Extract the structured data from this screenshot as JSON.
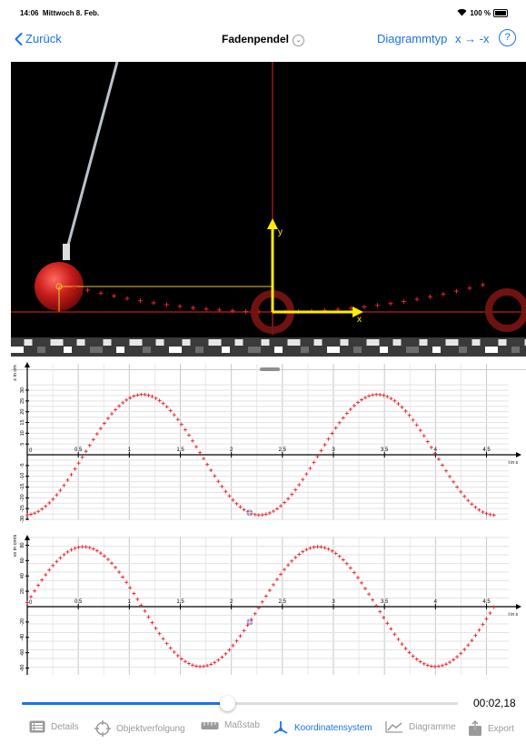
{
  "status": {
    "time": "14:06",
    "date": "Mittwoch 8. Feb.",
    "battery": "100 %"
  },
  "nav": {
    "back": "Zurück",
    "title": "Fadenpendel",
    "diagram_type": "Diagrammtyp",
    "flip": "x → -x",
    "help": "?"
  },
  "video": {
    "axis_x": "x",
    "axis_y": "y"
  },
  "chart_data": [
    {
      "type": "scatter",
      "x_label": "t in s",
      "y_label": "x in cm",
      "xlim": [
        0,
        4.6
      ],
      "ylim": [
        -30,
        30
      ],
      "x_ticks": [
        "0,5",
        "1",
        "1,5",
        "2",
        "2,5",
        "3",
        "3,5",
        "4",
        "4,5"
      ],
      "y_ticks_pos": [
        "5",
        "10",
        "15",
        "20",
        "25",
        "30"
      ],
      "y_ticks_neg": [
        "-5",
        "-10",
        "-15",
        "-20",
        "-25",
        "-30",
        "-35"
      ],
      "function": {
        "amplitude": 28,
        "period": 2.3,
        "phase_peak": 1.13
      },
      "marker_x": 2.18,
      "colors": {
        "points": "#e8242b",
        "marker": "#7a5ab0"
      }
    },
    {
      "type": "scatter",
      "x_label": "t in s",
      "y_label": "vx in cm/s",
      "xlim": [
        0,
        4.6
      ],
      "ylim": [
        -90,
        90
      ],
      "x_ticks": [
        "0,5",
        "1",
        "1,5",
        "2",
        "2,5",
        "3",
        "3,5",
        "4",
        "4,5"
      ],
      "y_ticks_pos": [
        "20",
        "40",
        "60",
        "80"
      ],
      "y_ticks_neg": [
        "-20",
        "-40",
        "-60",
        "-80"
      ],
      "function": {
        "amplitude": 78,
        "period": 2.3,
        "phase_peak": 0.55
      },
      "marker_x": 2.18,
      "colors": {
        "points": "#e8242b",
        "marker": "#7a5ab0"
      }
    }
  ],
  "playback": {
    "progress": 0.47,
    "time_label": "00:02,18"
  },
  "tabs": [
    {
      "label": "Details",
      "icon": "list-icon",
      "active": false
    },
    {
      "label": "Objektverfolgung",
      "icon": "crosshair-icon",
      "active": false
    },
    {
      "label": "Maßstab",
      "icon": "ruler-icon",
      "active": false
    },
    {
      "label": "Koordinatensystem",
      "icon": "axes-icon",
      "active": true
    },
    {
      "label": "Diagramme",
      "icon": "line-chart-icon",
      "active": false
    },
    {
      "label": "Export",
      "icon": "share-icon",
      "active": false
    }
  ]
}
